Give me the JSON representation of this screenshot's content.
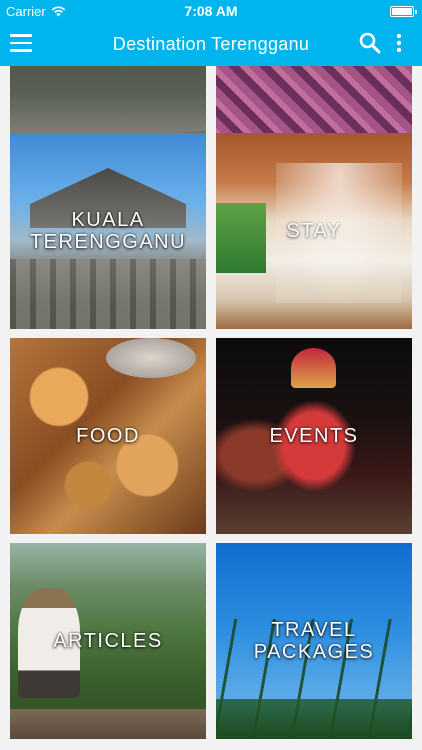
{
  "status_bar": {
    "carrier": "Carrier",
    "time": "7:08 AM"
  },
  "app_bar": {
    "title": "Destination Terengganu"
  },
  "tiles": [
    {
      "label": "KUALA\nTERENGGANU"
    },
    {
      "label": "STAY"
    },
    {
      "label": "FOOD"
    },
    {
      "label": "EVENTS"
    },
    {
      "label": "ARTICLES"
    },
    {
      "label": "TRAVEL\nPACKAGES"
    }
  ],
  "colors": {
    "accent": "#00b4ee",
    "background": "#f2f2f2",
    "text_on_accent": "#ffffff"
  },
  "icons": [
    "menu-icon",
    "search-icon",
    "more-vertical-icon",
    "wifi-icon",
    "battery-icon"
  ]
}
